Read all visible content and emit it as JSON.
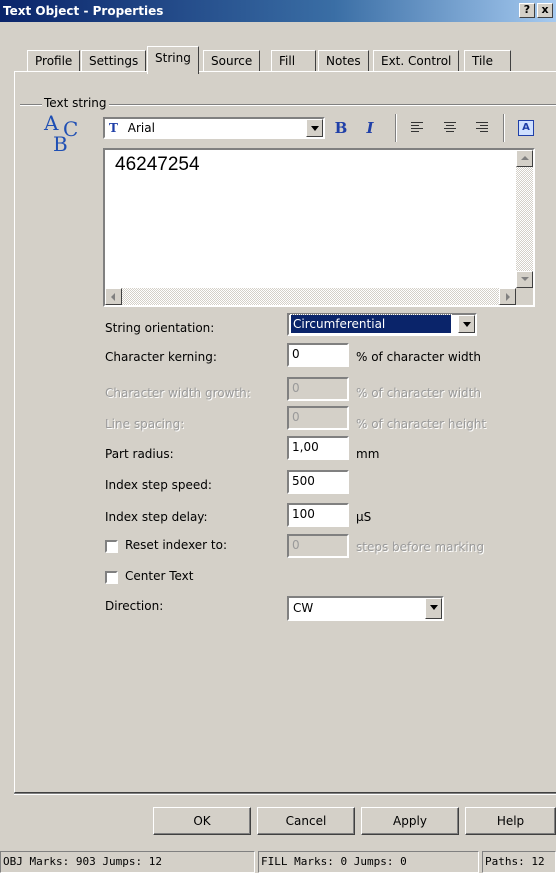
{
  "window": {
    "title": "Text Object - Properties",
    "help_btn": "?",
    "close_btn": "x"
  },
  "tabs": [
    "Profile",
    "Settings",
    "String",
    "Source",
    "Fill",
    "Notes",
    "Ext. Control",
    "Tile"
  ],
  "active_tab": "String",
  "group": {
    "label": "Text string"
  },
  "logo": {
    "a": "A",
    "c": "C",
    "b": "B"
  },
  "font": {
    "icon": "T",
    "name": "Arial"
  },
  "toolbar": {
    "bold": "B",
    "italic": "I",
    "align_left_icon": "align-left-icon",
    "align_center_icon": "align-center-icon",
    "align_right_icon": "align-right-icon",
    "autofit_icon": "A"
  },
  "text_value": "46247254",
  "form": {
    "orientation": {
      "label": "String orientation:",
      "value": "Circumferential"
    },
    "kerning": {
      "label": "Character kerning:",
      "value": "0",
      "unit": "% of character width"
    },
    "width_growth": {
      "label": "Character width growth:",
      "value": "0",
      "unit": "% of character width"
    },
    "line_spacing": {
      "label": "Line spacing:",
      "value": "0",
      "unit": "% of character height"
    },
    "part_radius": {
      "label": "Part radius:",
      "value": "1,00",
      "unit": "mm"
    },
    "index_speed": {
      "label": "Index step speed:",
      "value": "500"
    },
    "index_delay": {
      "label": "Index step delay:",
      "value": "100",
      "unit": "µS"
    },
    "reset_indexer": {
      "label": "Reset indexer to:",
      "value": "0",
      "unit": "steps before marking",
      "checked": false
    },
    "center_text": {
      "label": "Center Text",
      "checked": false
    },
    "direction": {
      "label": "Direction:",
      "value": "CW"
    }
  },
  "buttons": {
    "ok": "OK",
    "cancel": "Cancel",
    "apply": "Apply",
    "help": "Help"
  },
  "status": {
    "obj": "OBJ Marks: 903 Jumps: 12",
    "fill": "FILL Marks: 0 Jumps: 0",
    "paths": "Paths: 12"
  },
  "colors": {
    "title_bar": "#0a246a",
    "face": "#d4d0c8",
    "selection": "#0a246a",
    "logo": "#1f4fb4"
  }
}
